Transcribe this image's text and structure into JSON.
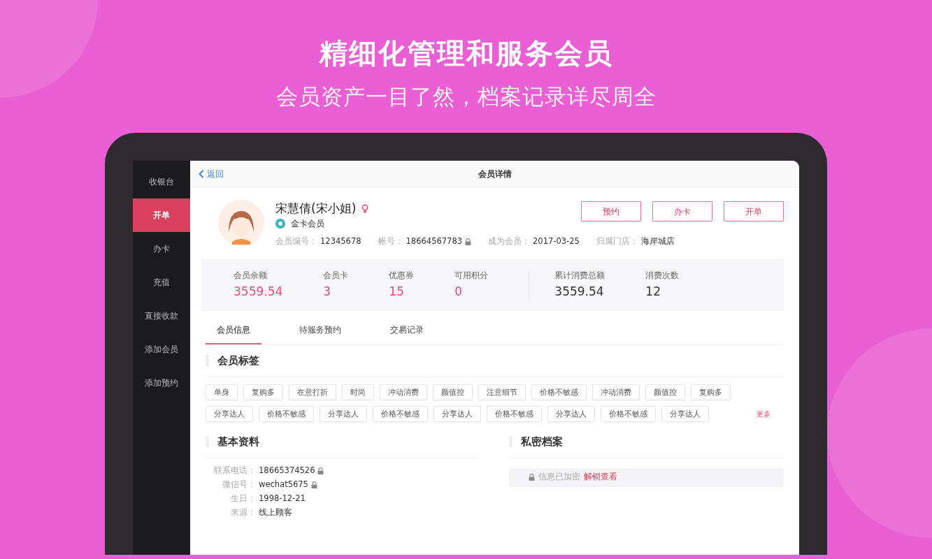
{
  "headline": "精细化管理和服务会员",
  "subheadline": "会员资产一目了然，档案记录详尽周全",
  "sidebar": {
    "items": [
      {
        "label": "收银台",
        "selected": false
      },
      {
        "label": "开单",
        "selected": true
      },
      {
        "label": "办卡",
        "selected": false
      },
      {
        "label": "充值",
        "selected": false
      },
      {
        "label": "直接收款",
        "selected": false
      },
      {
        "label": "添加会员",
        "selected": false
      },
      {
        "label": "添加预约",
        "selected": false
      }
    ]
  },
  "header": {
    "back": "返回",
    "title": "会员详情"
  },
  "profile": {
    "name": "宋慧倩(宋小姐)",
    "level": "金卡会员",
    "fields": [
      {
        "label": "会员编号：",
        "value": "12345678",
        "locked": false
      },
      {
        "label": "帐号：",
        "value": "18664567783",
        "locked": true
      },
      {
        "label": "成为会员：",
        "value": "2017-03-25",
        "locked": false
      },
      {
        "label": "归属门店：",
        "value": "海岸城店",
        "locked": false
      }
    ]
  },
  "actions": [
    "预约",
    "办卡",
    "开单"
  ],
  "stats": [
    {
      "kind": "asset",
      "label": "会员余额",
      "value": "3559.54"
    },
    {
      "kind": "asset",
      "label": "会员卡",
      "value": "3"
    },
    {
      "kind": "asset",
      "label": "优惠券",
      "value": "15"
    },
    {
      "kind": "asset",
      "label": "可用积分",
      "value": "0"
    },
    {
      "kind": "spending",
      "label": "累计消费总额",
      "value": "3559.54"
    },
    {
      "kind": "spending",
      "label": "消费次数",
      "value": "12"
    }
  ],
  "tabs": [
    {
      "label": "会员信息",
      "selected": true
    },
    {
      "label": "待服务预约",
      "selected": false
    },
    {
      "label": "交易记录",
      "selected": false
    }
  ],
  "tags": {
    "title": "会员标签",
    "items": [
      "单身",
      "复购多",
      "在意打折",
      "时尚",
      "冲动消费",
      "颜值控",
      "注意细节",
      "价格不敏感",
      "冲动消费",
      "颜值控",
      "复购多",
      "分享达人",
      "价格不敏感",
      "分享达人",
      "价格不敏感",
      "分享达人",
      "价格不敏感",
      "分享达人",
      "价格不敏感",
      "分享达人"
    ],
    "more": "更多"
  },
  "basic": {
    "title": "基本资料",
    "fields": [
      {
        "label": "联系电话：",
        "value": "18665374526",
        "locked": true
      },
      {
        "label": "微信号：",
        "value": "wechat5675",
        "locked": true
      },
      {
        "label": "生日：",
        "value": "1998-12-21",
        "locked": false
      },
      {
        "label": "来源：",
        "value": "线上顾客",
        "locked": false
      }
    ]
  },
  "private": {
    "title": "私密档案",
    "notice": "信息已加密",
    "unlock": "解锁查看"
  }
}
